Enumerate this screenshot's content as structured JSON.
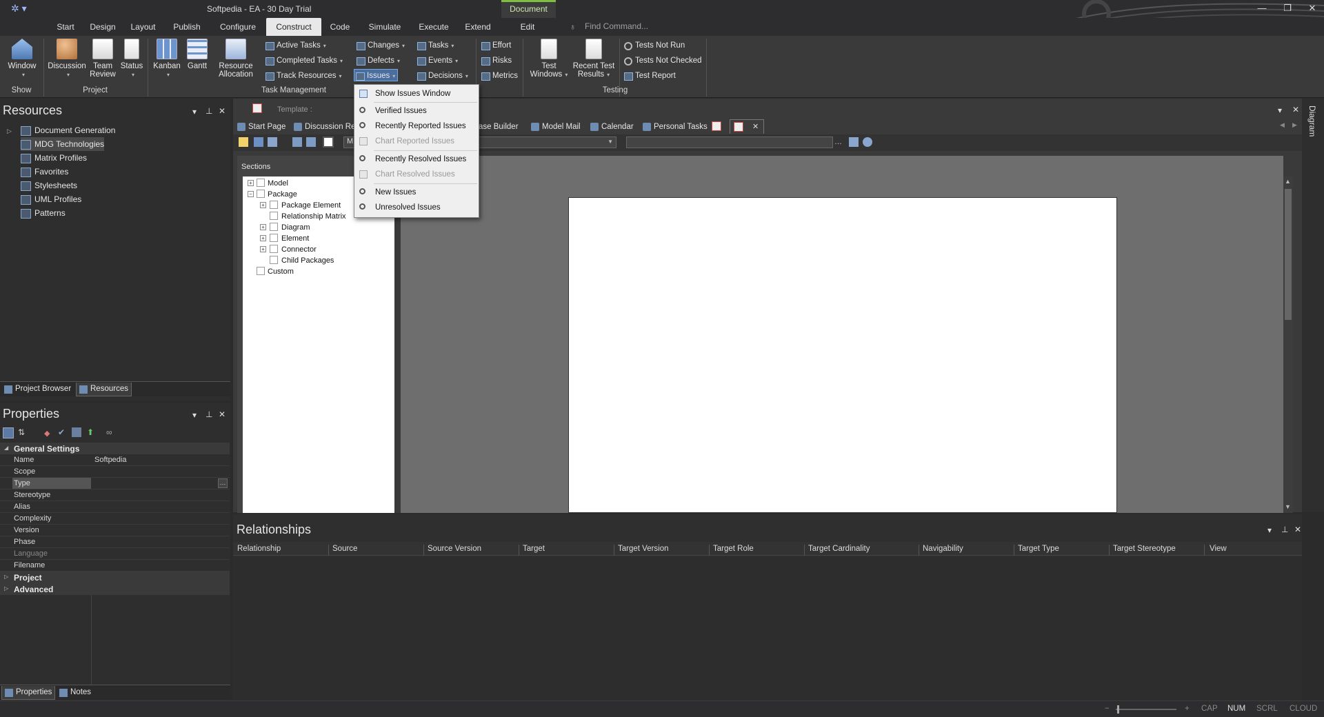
{
  "window": {
    "title": "Softpedia - EA - 30 Day Trial",
    "context_tab": "Document"
  },
  "menu": {
    "tabs": [
      "Start",
      "Design",
      "Layout",
      "Publish",
      "Configure",
      "Construct",
      "Code",
      "Simulate",
      "Execute",
      "Extend",
      "Edit"
    ],
    "active": "Construct",
    "find_placeholder": "Find Command..."
  },
  "ribbon": {
    "show": {
      "window": "Window",
      "group": "Show"
    },
    "project": {
      "discussion": "Discussion",
      "team_review_1": "Team",
      "team_review_2": "Review",
      "status": "Status",
      "group": "Project"
    },
    "task_mgmt": {
      "kanban": "Kanban",
      "gantt": "Gantt",
      "resource_1": "Resource",
      "resource_2": "Allocation",
      "active_tasks": "Active Tasks",
      "completed_tasks": "Completed Tasks",
      "track_resources": "Track Resources",
      "changes": "Changes",
      "defects": "Defects",
      "issues": "Issues",
      "tasks": "Tasks",
      "events": "Events",
      "decisions": "Decisions",
      "effort": "Effort",
      "risks": "Risks",
      "metrics": "Metrics",
      "group": "Task Management"
    },
    "testing": {
      "test_windows_1": "Test",
      "test_windows_2": "Windows",
      "recent_results_1": "Recent Test",
      "recent_results_2": "Results",
      "tests_not_run": "Tests Not Run",
      "tests_not_checked": "Tests Not Checked",
      "test_report": "Test Report",
      "group": "Testing"
    }
  },
  "issues_menu": {
    "items": [
      {
        "label": "Show Issues Window",
        "enabled": true,
        "icon": "window-icon"
      },
      {
        "label": "Verified Issues",
        "enabled": true,
        "icon": "search-icon"
      },
      {
        "label": "Recently Reported Issues",
        "enabled": true,
        "icon": "search-icon"
      },
      {
        "label": "Chart Reported Issues",
        "enabled": false,
        "icon": "chart-icon"
      },
      {
        "label": "Recently Resolved Issues",
        "enabled": true,
        "icon": "search-icon"
      },
      {
        "label": "Chart Resolved Issues",
        "enabled": false,
        "icon": "chart-icon"
      },
      {
        "label": "New Issues",
        "enabled": true,
        "icon": "search-icon"
      },
      {
        "label": "Unresolved Issues",
        "enabled": true,
        "icon": "search-icon"
      }
    ]
  },
  "resources": {
    "title": "Resources",
    "items": [
      "Document Generation",
      "MDG Technologies",
      "Matrix Profiles",
      "Favorites",
      "Stylesheets",
      "UML Profiles",
      "Patterns"
    ],
    "selected": "MDG Technologies",
    "tabs": [
      "Project Browser",
      "Resources"
    ]
  },
  "properties": {
    "title": "Properties",
    "category_general": "General Settings",
    "rows": [
      {
        "k": "Name",
        "v": "Softpedia"
      },
      {
        "k": "Scope",
        "v": ""
      },
      {
        "k": "Type",
        "v": ""
      },
      {
        "k": "Stereotype",
        "v": ""
      },
      {
        "k": "Alias",
        "v": ""
      },
      {
        "k": "Complexity",
        "v": ""
      },
      {
        "k": "Version",
        "v": ""
      },
      {
        "k": "Phase",
        "v": ""
      },
      {
        "k": "Language",
        "v": ""
      },
      {
        "k": "Filename",
        "v": ""
      }
    ],
    "category_project": "Project",
    "category_advanced": "Advanced",
    "tabs": [
      "Properties",
      "Notes"
    ]
  },
  "document": {
    "template_label": "Template :",
    "tabs": [
      "Start Page",
      "Discussion Re",
      "ase Builder",
      "Model Mail",
      "Calendar",
      "Personal Tasks"
    ],
    "combo_value": "M",
    "sections_title": "Sections",
    "sections": {
      "model": "Model",
      "package": "Package",
      "package_element": "Package Element",
      "relationship_matrix": "Relationship Matrix",
      "diagram": "Diagram",
      "element": "Element",
      "connector": "Connector",
      "child_packages": "Child Packages",
      "custom": "Custom"
    },
    "side_label": "Diagram"
  },
  "relationships": {
    "title": "Relationships",
    "columns": [
      "Relationship",
      "Source",
      "Source Version",
      "Target",
      "Target Version",
      "Target Role",
      "Target Cardinality",
      "Navigability",
      "Target Type",
      "Target Stereotype",
      "View"
    ]
  },
  "statusbar": {
    "cap": "CAP",
    "num": "NUM",
    "scrl": "SCRL",
    "cloud": "CLOUD"
  }
}
